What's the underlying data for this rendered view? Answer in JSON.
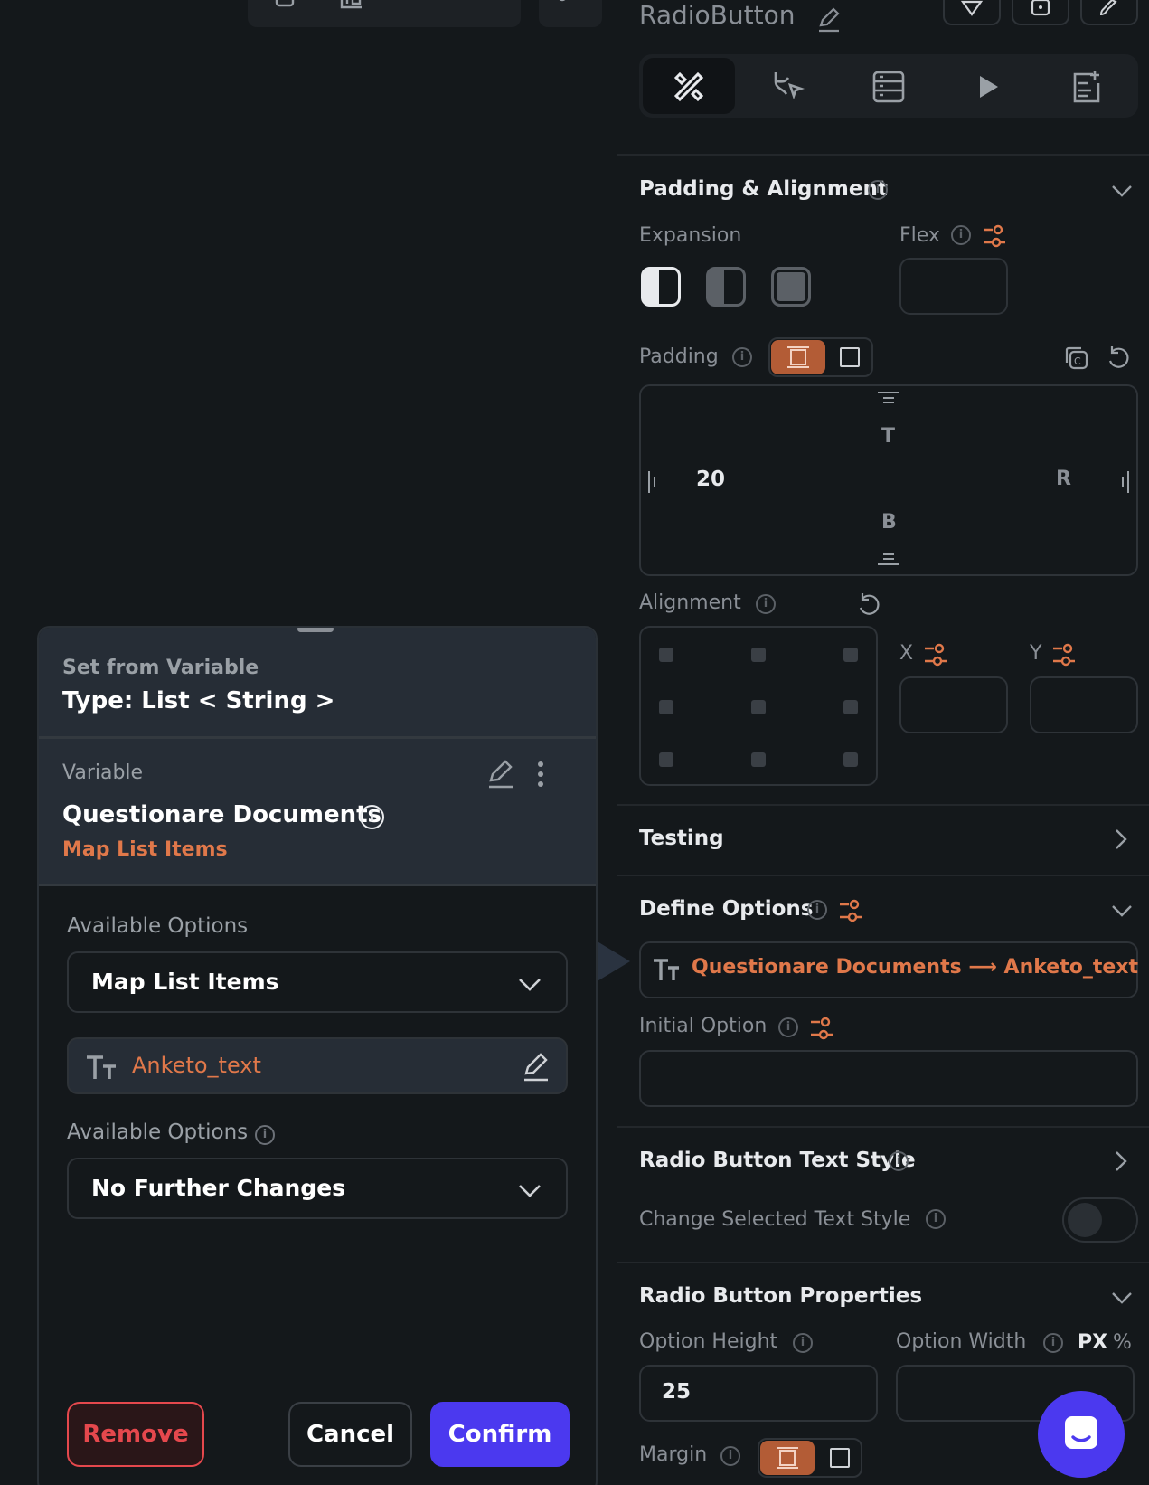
{
  "header": {
    "component_name": "RadioButton"
  },
  "dialog": {
    "title": "Set from Variable",
    "type_label": "Type: List < String >",
    "variable_label": "Variable",
    "variable_name": "Questionare Documents",
    "variable_sub": "Map List Items",
    "options1_label": "Available Options",
    "options1_value": "Map List Items",
    "field_value": "Anketo_text",
    "options2_label": "Available Options",
    "options2_value": "No Further Changes",
    "remove": "Remove",
    "cancel": "Cancel",
    "confirm": "Confirm"
  },
  "panel": {
    "padding_alignment": "Padding & Alignment",
    "expansion": "Expansion",
    "flex": "Flex",
    "padding": "Padding",
    "pad_t": "T",
    "pad_b": "B",
    "pad_r": "R",
    "pad_l_value": "20",
    "alignment": "Alignment",
    "x": "X",
    "y": "Y",
    "testing": "Testing",
    "define_options": "Define Options",
    "define_value": "Questionare Documents ⟶ Anketo_text",
    "initial_option": "Initial Option",
    "text_style": "Radio Button Text Style",
    "change_selected": "Change Selected Text Style",
    "properties": "Radio Button Properties",
    "option_height": "Option Height",
    "option_height_value": "25",
    "option_width": "Option Width",
    "px": "PX",
    "pct": "%",
    "margin": "Margin"
  },
  "colors": {
    "accent": "#e0784a",
    "primary": "#4b39ef",
    "danger": "#e5484d"
  }
}
